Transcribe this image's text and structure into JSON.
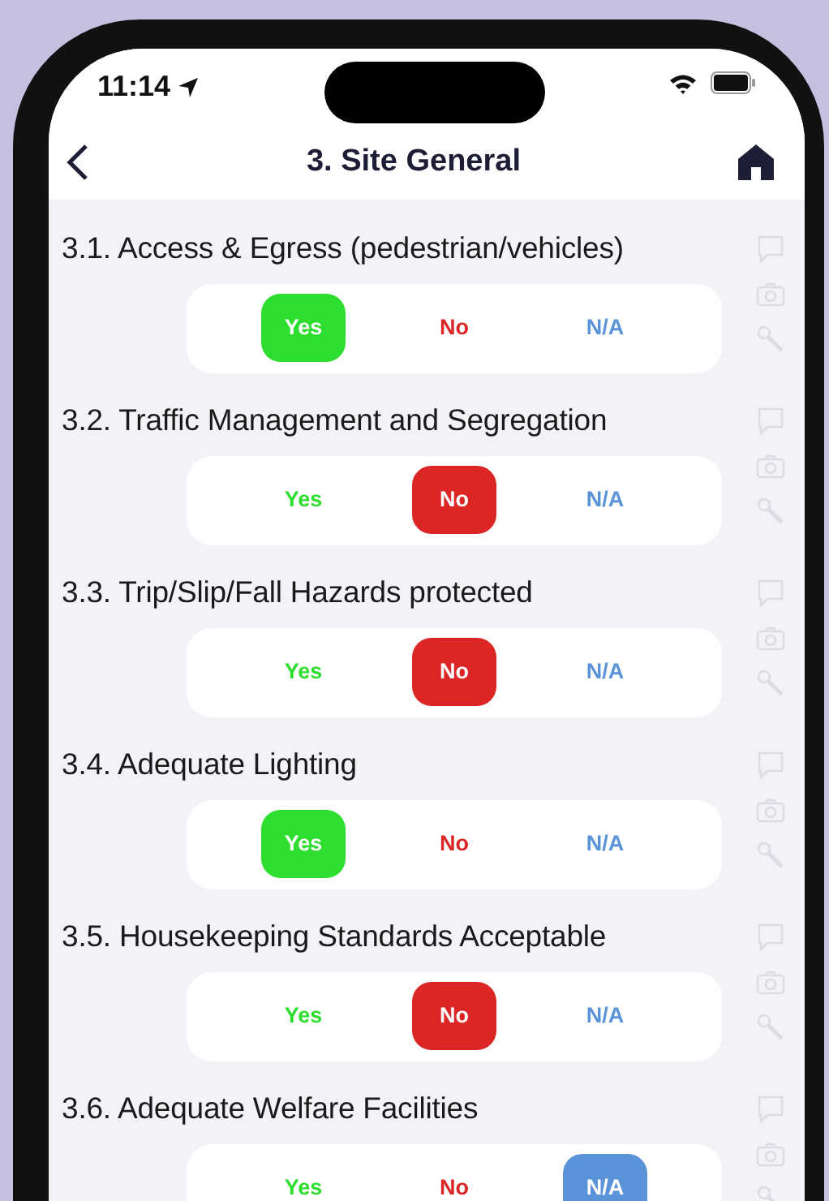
{
  "status_bar": {
    "time": "11:14"
  },
  "header": {
    "title": "3. Site General"
  },
  "questions": [
    {
      "text": "3.1. Access & Egress (pedestrian/vehicles)",
      "options": [
        {
          "kind": "yes",
          "label": "Yes",
          "selected": true
        },
        {
          "kind": "no",
          "label": "No",
          "selected": false
        },
        {
          "kind": "na",
          "label": "N/A",
          "selected": false
        }
      ]
    },
    {
      "text": "3.2. Traffic Management and Segregation",
      "options": [
        {
          "kind": "yes",
          "label": "Yes",
          "selected": false
        },
        {
          "kind": "no",
          "label": "No",
          "selected": true
        },
        {
          "kind": "na",
          "label": "N/A",
          "selected": false
        }
      ]
    },
    {
      "text": "3.3. Trip/Slip/Fall Hazards protected",
      "options": [
        {
          "kind": "yes",
          "label": "Yes",
          "selected": false
        },
        {
          "kind": "no",
          "label": "No",
          "selected": true
        },
        {
          "kind": "na",
          "label": "N/A",
          "selected": false
        }
      ]
    },
    {
      "text": "3.4. Adequate Lighting",
      "options": [
        {
          "kind": "yes",
          "label": "Yes",
          "selected": true
        },
        {
          "kind": "no",
          "label": "No",
          "selected": false
        },
        {
          "kind": "na",
          "label": "N/A",
          "selected": false
        }
      ]
    },
    {
      "text": "3.5. Housekeeping Standards Acceptable",
      "options": [
        {
          "kind": "yes",
          "label": "Yes",
          "selected": false
        },
        {
          "kind": "no",
          "label": "No",
          "selected": true
        },
        {
          "kind": "na",
          "label": "N/A",
          "selected": false
        }
      ]
    },
    {
      "text": "3.6. Adequate Welfare Facilities",
      "options": [
        {
          "kind": "yes",
          "label": "Yes",
          "selected": false
        },
        {
          "kind": "no",
          "label": "No",
          "selected": false
        },
        {
          "kind": "na",
          "label": "N/A",
          "selected": true
        }
      ]
    }
  ]
}
